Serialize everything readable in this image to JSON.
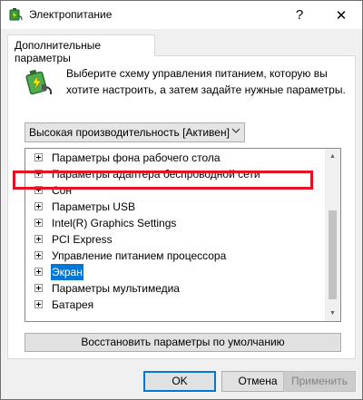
{
  "window": {
    "title": "Электропитание",
    "help_glyph": "?",
    "close_glyph": "✕"
  },
  "tab": {
    "label": "Дополнительные параметры"
  },
  "description": "Выберите схему управления питанием, которую вы хотите настроить, а затем задайте нужные параметры.",
  "scheme": {
    "selected": "Высокая производительность [Активен]"
  },
  "tree": {
    "items": [
      {
        "label": "Параметры фона рабочего стола"
      },
      {
        "label": "Параметры адаптера беспроводной сети"
      },
      {
        "label": "Сон"
      },
      {
        "label": "Параметры USB"
      },
      {
        "label": "Intel(R) Graphics Settings"
      },
      {
        "label": "PCI Express"
      },
      {
        "label": "Управление питанием процессора"
      },
      {
        "label": "Экран",
        "selected": true
      },
      {
        "label": "Параметры мультимедиа"
      },
      {
        "label": "Батарея"
      }
    ]
  },
  "buttons": {
    "restore": "Восстановить параметры по умолчанию",
    "ok": "OK",
    "cancel": "Отмена",
    "apply": "Применить"
  },
  "colors": {
    "selection": "#0078d7",
    "highlight_border": "#e81123"
  },
  "icons": {
    "title": "power-options-icon",
    "header": "battery-plug-icon"
  }
}
